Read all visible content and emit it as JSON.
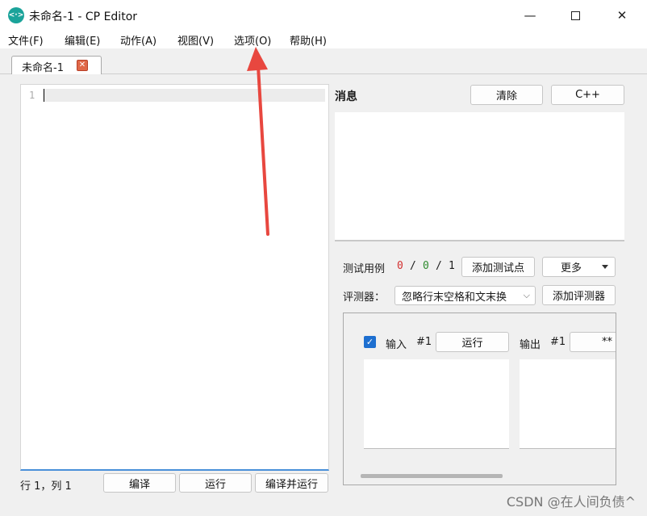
{
  "window": {
    "title": "未命名-1 - CP Editor",
    "icon_text": "<·>",
    "minimize": "—",
    "close": "✕"
  },
  "menu": [
    "文件(F)",
    "编辑(E)",
    "动作(A)",
    "视图(V)",
    "选项(O)",
    "帮助(H)"
  ],
  "tab": {
    "label": "未命名-1",
    "close": "✕"
  },
  "editor": {
    "line_number": "1"
  },
  "status": {
    "position": "行 1，列 1",
    "compile": "编译",
    "run": "运行",
    "compile_run": "编译并运行"
  },
  "messages": {
    "title": "消息",
    "clear": "清除",
    "language": "C++"
  },
  "tests": {
    "label": "测试用例",
    "failed": "0",
    "sep1": "/",
    "passed": "0",
    "sep2": "/",
    "total": "1",
    "add_test": "添加测试点",
    "more": "更多"
  },
  "checker": {
    "label": "评测器：",
    "value": "忽略行末空格和文末换",
    "add": "添加评测器"
  },
  "testcase": {
    "input_label": "输入",
    "input_id": "#1",
    "run": "运行",
    "output_label": "输出",
    "output_id": "#1",
    "stars": "**",
    "check": "✓"
  },
  "watermark": "CSDN @在人间负债^",
  "colors": {
    "failed": "#d32f2f",
    "passed": "#2e8b2e",
    "arrow": "#e8473f",
    "checkbox": "#1d6fd0"
  }
}
